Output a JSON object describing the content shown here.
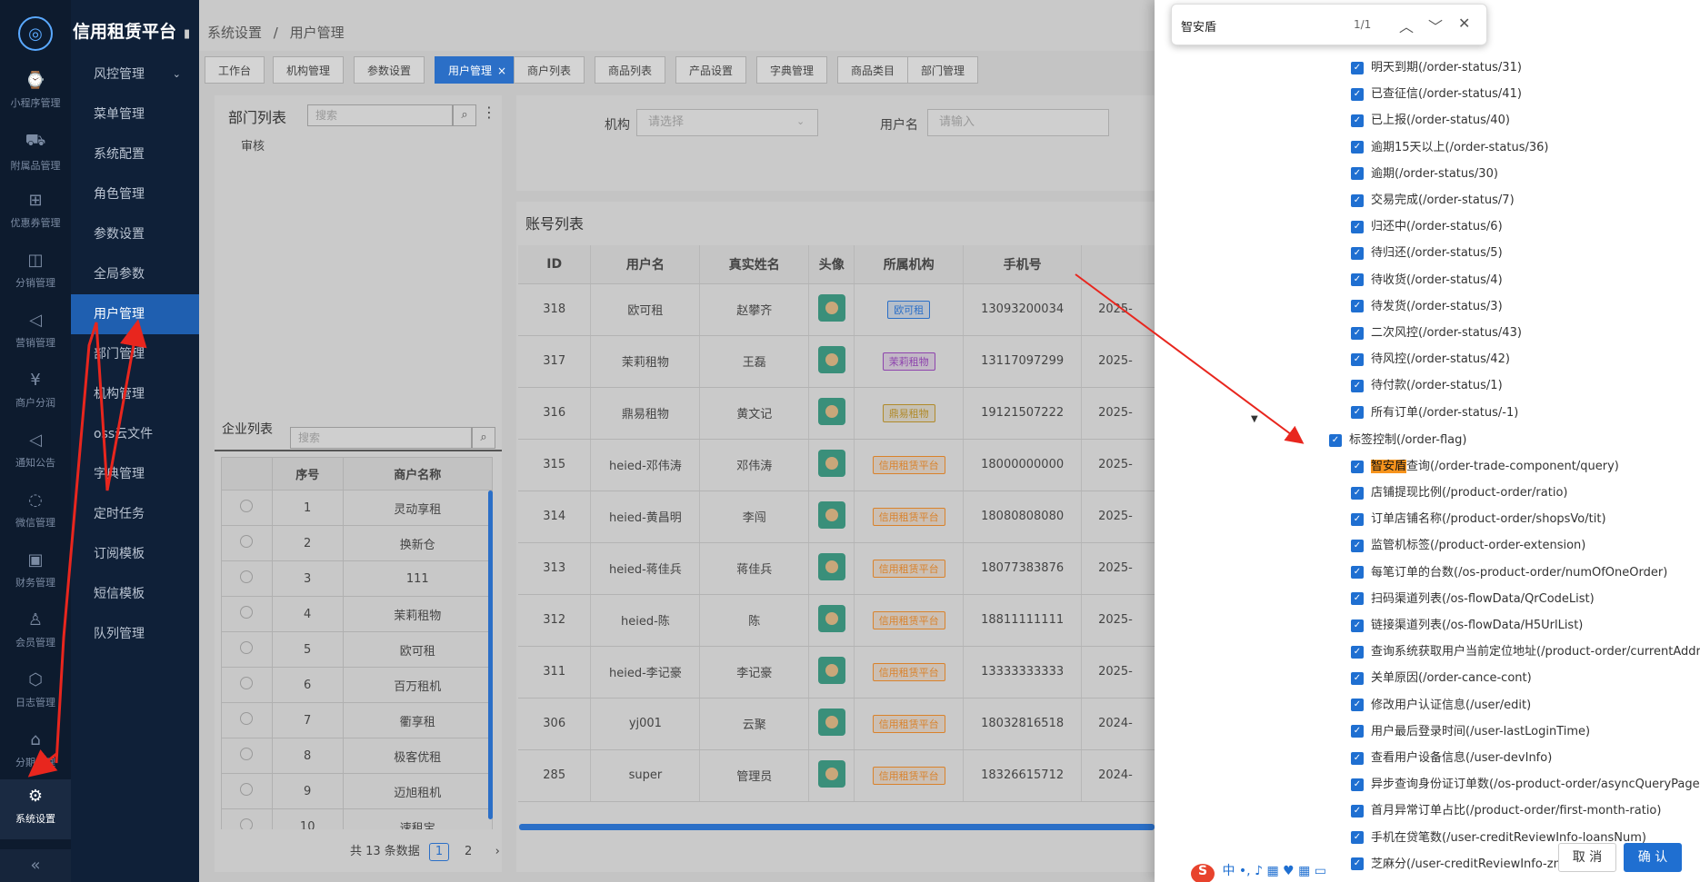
{
  "app": {
    "title": "信用租赁平台"
  },
  "iconbar": [
    {
      "label": "小程序管理",
      "icon": "mini-program-icon"
    },
    {
      "label": "附属品管理",
      "icon": "cart-icon"
    },
    {
      "label": "优惠券管理",
      "icon": "gift-icon"
    },
    {
      "label": "分销管理",
      "icon": "chart-icon"
    },
    {
      "label": "营销管理",
      "icon": "megaphone-icon"
    },
    {
      "label": "商户分润",
      "icon": "yen-icon"
    },
    {
      "label": "通知公告",
      "icon": "bell-icon"
    },
    {
      "label": "微信管理",
      "icon": "wechat-icon"
    },
    {
      "label": "财务管理",
      "icon": "finance-icon"
    },
    {
      "label": "会员管理",
      "icon": "member-icon"
    },
    {
      "label": "日志管理",
      "icon": "log-icon"
    },
    {
      "label": "分期管理",
      "icon": "installment-icon"
    },
    {
      "label": "系统设置",
      "icon": "gear-icon"
    }
  ],
  "sidebar": {
    "items": [
      {
        "label": "风控管理"
      },
      {
        "label": "菜单管理"
      },
      {
        "label": "系统配置"
      },
      {
        "label": "角色管理"
      },
      {
        "label": "参数设置"
      },
      {
        "label": "全局参数"
      },
      {
        "label": "用户管理"
      },
      {
        "label": "部门管理"
      },
      {
        "label": "机构管理"
      },
      {
        "label": "oss云文件"
      },
      {
        "label": "字典管理"
      },
      {
        "label": "定时任务"
      },
      {
        "label": "订阅模板"
      },
      {
        "label": "短信模板"
      },
      {
        "label": "队列管理"
      }
    ]
  },
  "breadcrumb": {
    "parent": "系统设置",
    "sep": "/",
    "current": "用户管理"
  },
  "tabs": [
    "工作台",
    "机构管理",
    "参数设置",
    "用户管理",
    "商户列表",
    "商品列表",
    "产品设置",
    "字典管理",
    "商品类目",
    "部门管理"
  ],
  "tab_close": "×",
  "dept": {
    "title": "部门列表",
    "search_placeholder": "搜索",
    "node": "审核"
  },
  "enterprise": {
    "title": "企业列表",
    "search_placeholder": "搜索",
    "headers": [
      "",
      "序号",
      "商户名称"
    ],
    "rows": [
      [
        "1",
        "灵动享租"
      ],
      [
        "2",
        "换新仓"
      ],
      [
        "3",
        "111"
      ],
      [
        "4",
        "茉莉租物"
      ],
      [
        "5",
        "欧可租"
      ],
      [
        "6",
        "百万租机"
      ],
      [
        "7",
        "衢享租"
      ],
      [
        "8",
        "极客优租"
      ],
      [
        "9",
        "迈旭租机"
      ],
      [
        "10",
        "速租宝"
      ]
    ],
    "pager": {
      "total": "共 13 条数据",
      "p1": "1",
      "p2": "2",
      "next": "›"
    }
  },
  "filters": {
    "org_label": "机构",
    "org_placeholder": "请选择",
    "user_label": "用户名",
    "user_placeholder": "请输入"
  },
  "accounts": {
    "title": "账号列表",
    "headers": [
      "ID",
      "用户名",
      "真实姓名",
      "头像",
      "所属机构",
      "手机号",
      ""
    ],
    "rows": [
      [
        "318",
        "欧可租",
        "赵攀齐",
        "欧可租",
        "13093200034",
        "2025-"
      ],
      [
        "317",
        "茉莉租物",
        "王磊",
        "茉莉租物",
        "13117097299",
        "2025-"
      ],
      [
        "316",
        "鼎易租物",
        "黄文记",
        "鼎易租物",
        "19121507222",
        "2025-"
      ],
      [
        "315",
        "heied-邓伟涛",
        "邓伟涛",
        "信用租赁平台",
        "18000000000",
        "2025-"
      ],
      [
        "314",
        "heied-黄昌明",
        "李闯",
        "信用租赁平台",
        "18080808080",
        "2025-"
      ],
      [
        "313",
        "heied-蒋佳兵",
        "蒋佳兵",
        "信用租赁平台",
        "18077383876",
        "2025-"
      ],
      [
        "312",
        "heied-陈",
        "陈",
        "信用租赁平台",
        "18811111111",
        "2025-"
      ],
      [
        "311",
        "heied-李记豪",
        "李记豪",
        "信用租赁平台",
        "13333333333",
        "2025-"
      ],
      [
        "306",
        "yj001",
        "云聚",
        "信用租赁平台",
        "18032816518",
        "2024-"
      ],
      [
        "285",
        "super",
        "管理员",
        "信用租赁平台",
        "18326615712",
        "2024-"
      ]
    ],
    "tag_colors": {
      "欧可租": "#2b6fc7",
      "茉莉租物": "#8e44ad",
      "鼎易租物": "#b08a2a",
      "信用租赁平台": "#d9822b"
    }
  },
  "find": {
    "query": "智安盾",
    "count": "1/1"
  },
  "tree": {
    "items": [
      "明天到期(/order-status/31)",
      "已查征信(/order-status/41)",
      "已上报(/order-status/40)",
      "逾期15天以上(/order-status/36)",
      "逾期(/order-status/30)",
      "交易完成(/order-status/7)",
      "归还中(/order-status/6)",
      "待归还(/order-status/5)",
      "待收货(/order-status/4)",
      "待发货(/order-status/3)",
      "二次风控(/order-status/43)",
      "待风控(/order-status/42)",
      "待付款(/order-status/1)",
      "所有订单(/order-status/-1)"
    ],
    "parent": "标签控制(/order-flag)",
    "highlight": "智安盾",
    "first_child_rest": "查询(/order-trade-component/query)",
    "children": [
      "店铺提现比例(/product-order/ratio)",
      "订单店铺名称(/product-order/shopsVo/tit)",
      "监管机标签(/product-order-extension)",
      "每笔订单的台数(/os-product-order/numOfOneOrder)",
      "扫码渠道列表(/os-flowData/QrCodeList)",
      "链接渠道列表(/os-flowData/H5UrlList)",
      "查询系统获取用户当前定位地址(/product-order/currentAddress)",
      "关单原因(/order-cance-cont)",
      "修改用户认证信息(/user/edit)",
      "用户最后登录时间(/user-lastLoginTime)",
      "查看用户设备信息(/user-devInfo)",
      "异步查询身份证订单数(/os-product-order/asyncQueryPage)",
      "首月异常订单占比(/product-order/first-month-ratio)",
      "手机在贷笔数(/user-creditReviewInfo-loansNum)",
      "芝麻分(/user-creditReviewInfo-zmf)"
    ]
  },
  "buttons": {
    "cancel": "取 消",
    "ok": "确 认"
  },
  "ime": {
    "logo": "S",
    "mode": "中"
  },
  "colors": {
    "accent": "#1f6fd1",
    "annotation": "#e8261e"
  }
}
